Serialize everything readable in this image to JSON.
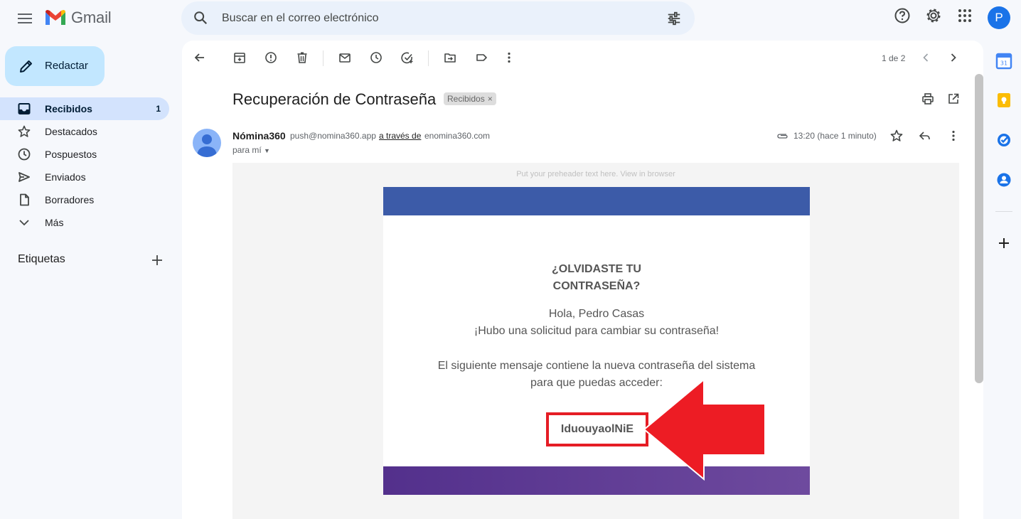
{
  "app": {
    "logo_text": "Gmail",
    "search_placeholder": "Buscar en el correo electrónico",
    "account_initial": "P"
  },
  "colors": {
    "compose_bg": "#c2e7ff",
    "active_nav_bg": "#d3e3fd",
    "email_header": "#3c5ba8",
    "email_footer": "#53308c",
    "highlight_red": "#e51d25",
    "avatar_blue": "#1a73e8"
  },
  "sidebar": {
    "compose_label": "Redactar",
    "items": [
      {
        "label": "Recibidos",
        "count": "1",
        "icon": "inbox-icon"
      },
      {
        "label": "Destacados",
        "count": "",
        "icon": "star-icon"
      },
      {
        "label": "Pospuestos",
        "count": "",
        "icon": "clock-icon"
      },
      {
        "label": "Enviados",
        "count": "",
        "icon": "send-icon"
      },
      {
        "label": "Borradores",
        "count": "",
        "icon": "draft-icon"
      },
      {
        "label": "Más",
        "count": "",
        "icon": "chevron-down-icon"
      }
    ],
    "labels_heading": "Etiquetas"
  },
  "toolbar": {
    "pager": "1 de 2"
  },
  "email": {
    "subject": "Recuperación de Contraseña",
    "label_chip": "Recibidos",
    "label_chip_close": "×",
    "sender_name": "Nómina360",
    "sender_email": "push@nomina360.app",
    "via_text": "a través de",
    "via_domain": "enomina360.com",
    "recipient": "para mí",
    "time": "13:20 (hace 1 minuto)",
    "preheader": "Put your preheader text here. View in browser",
    "heading_line1": "¿OLVIDASTE TU",
    "heading_line2": "CONTRASEÑA?",
    "greeting": "Hola, Pedro Casas",
    "request_line": "¡Hubo una solicitud para cambiar su contraseña!",
    "info_line1": "El siguiente mensaje contiene la nueva contraseña del sistema",
    "info_line2": "para que puedas acceder:",
    "password": "IduouyaolNiE"
  }
}
